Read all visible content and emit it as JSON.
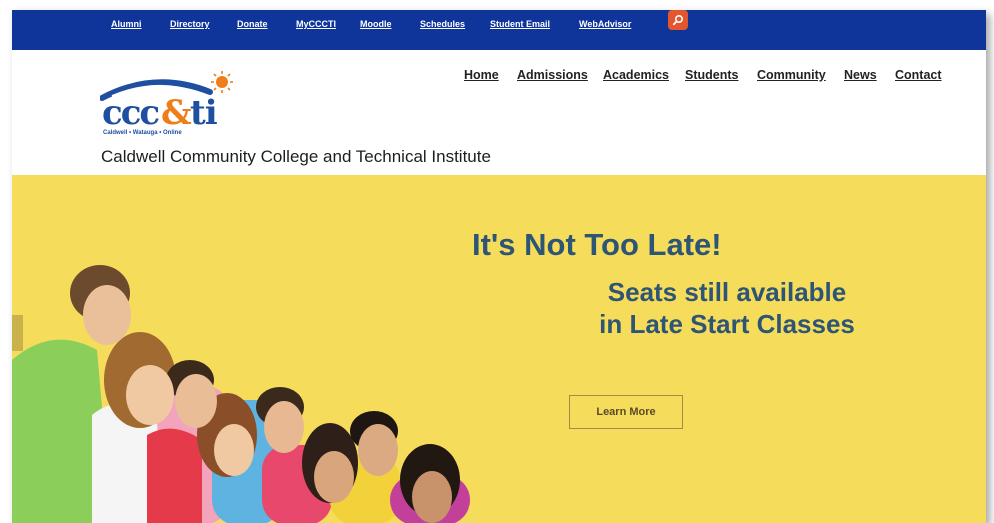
{
  "utility_nav": {
    "items": [
      "Alumni",
      "Directory",
      "Donate",
      "MyCCCTI",
      "Moodle",
      "Schedules",
      "Student Email",
      "WebAdvisor"
    ]
  },
  "search": {
    "icon": "search-icon"
  },
  "logo": {
    "wordmark": "ccc&ti",
    "tagline": "Caldwell • Watauga • Online"
  },
  "site_title": "Caldwell Community College and Technical Institute",
  "main_nav": {
    "items": [
      "Home",
      "Admissions",
      "Academics",
      "Students",
      "Community",
      "News",
      "Contact"
    ]
  },
  "hero": {
    "title": "It's Not Too Late!",
    "subtitle_line1": "Seats still available",
    "subtitle_line2": "in Late Start Classes",
    "button_label": "Learn More"
  },
  "colors": {
    "topbar": "#10359a",
    "hero_bg": "#f5dc5b",
    "hero_text": "#2e5575",
    "search_button": "#e4572e",
    "logo_blue": "#1f4fa0",
    "logo_orange": "#ef7d1a"
  }
}
